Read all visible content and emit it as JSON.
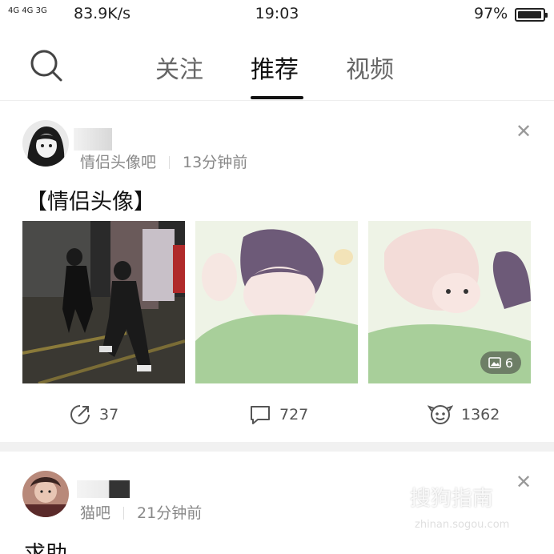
{
  "status_bar": {
    "network": "4G 4G 3G",
    "speed": "83.9K/s",
    "time": "19:03",
    "battery": "97%"
  },
  "nav": {
    "tabs": [
      {
        "label": "关注"
      },
      {
        "label": "推荐"
      },
      {
        "label": "视频"
      }
    ],
    "active_tab": "推荐"
  },
  "posts": [
    {
      "group": "情侣头像吧",
      "time": "13分钟前",
      "title": "【情侣头像】",
      "image_count": "6",
      "shares": "37",
      "comments": "727",
      "likes": "1362"
    },
    {
      "group": "猫吧",
      "time": "21分钟前",
      "title": "求助"
    }
  ],
  "watermark": {
    "text": "搜狗指南",
    "url": "zhinan.sogou.com"
  }
}
